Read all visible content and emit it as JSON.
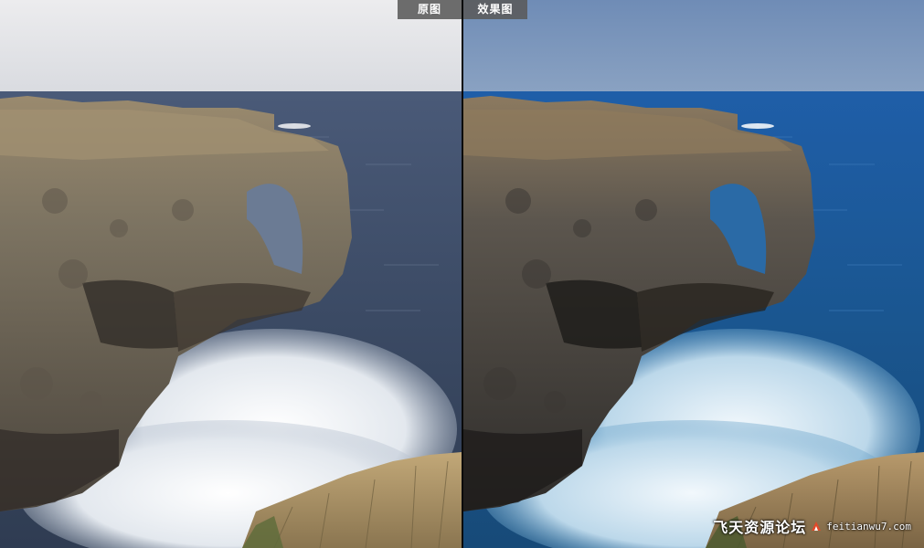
{
  "labels": {
    "original": "原图",
    "effect": "效果图"
  },
  "watermark": {
    "cn_text": "飞天资源论坛",
    "url_text": "feitianwu7.com"
  },
  "colors": {
    "original_sky": "#e6e6e8",
    "original_sea": "#3d4c66",
    "effect_sky": "#7a93b8",
    "effect_sea": "#1a5e9a"
  }
}
